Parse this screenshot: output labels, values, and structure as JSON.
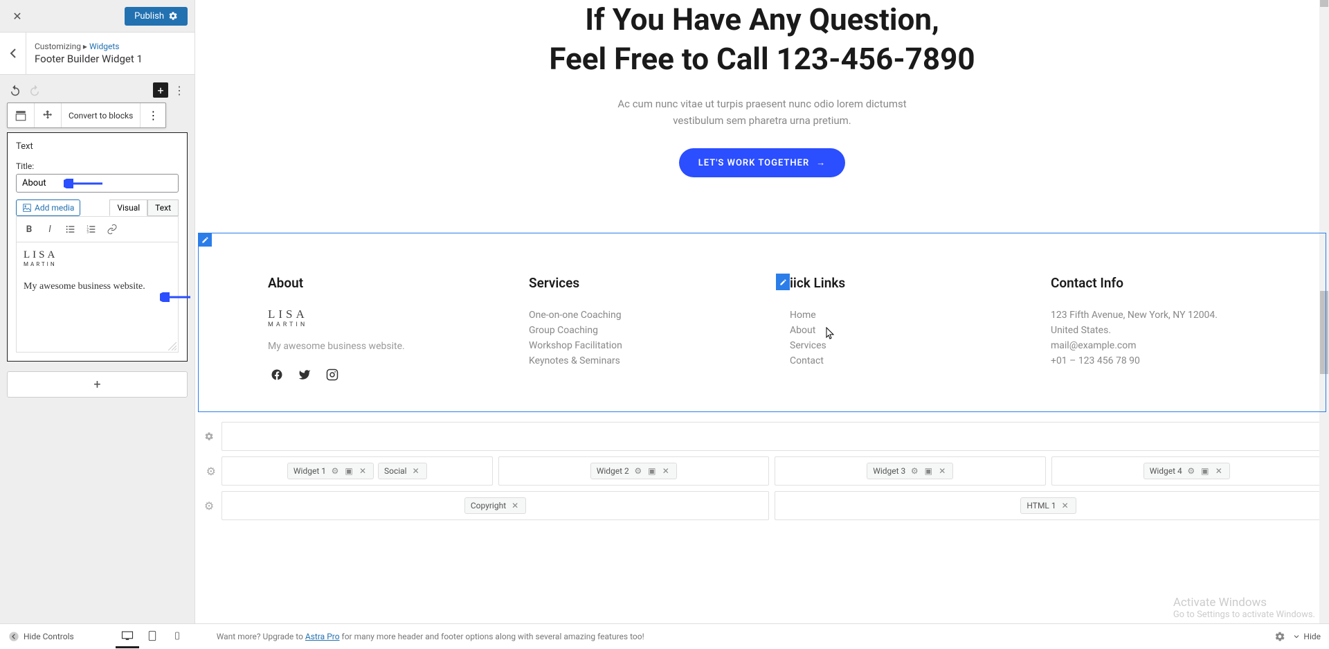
{
  "sidebar": {
    "publish_label": "Publish",
    "breadcrumb_prefix": "Customizing",
    "breadcrumb_link": "Widgets",
    "breadcrumb_title": "Footer Builder Widget 1",
    "convert_label": "Convert to blocks",
    "widget_type": "Text",
    "title_label": "Title:",
    "title_value": "About",
    "add_media_label": "Add media",
    "tab_visual": "Visual",
    "tab_text": "Text",
    "logo_top": "LISA",
    "logo_sub": "MARTIN",
    "body_text": "My awesome business website."
  },
  "hero": {
    "line1": "If You Have Any Question,",
    "line2": "Feel Free to Call 123-456-7890",
    "sub1": "Ac cum nunc vitae ut turpis praesent nunc odio lorem dictumst",
    "sub2": "vestibulum sem pharetra urna pretium.",
    "cta": "LET'S WORK TOGETHER"
  },
  "footer": {
    "about": {
      "title": "About",
      "logo_top": "LISA",
      "logo_sub": "MARTIN",
      "desc": "My awesome business website."
    },
    "services": {
      "title": "Services",
      "items": [
        "One-on-one Coaching",
        "Group Coaching",
        "Workshop Facilitation",
        "Keynotes & Seminars"
      ]
    },
    "quicklinks": {
      "title": "Quick Links",
      "title_partial": "iick Links",
      "items": [
        "Home",
        "About",
        "Services",
        "Contact"
      ]
    },
    "contact": {
      "title": "Contact Info",
      "items": [
        "123 Fifth Avenue, New York, NY 12004.",
        "United States.",
        "mail@example.com",
        "+01 – 123 456 78 90"
      ]
    }
  },
  "builder": {
    "widget1": "Widget 1",
    "social": "Social",
    "widget2": "Widget 2",
    "widget3": "Widget 3",
    "widget4": "Widget 4",
    "copyright": "Copyright",
    "html1": "HTML 1"
  },
  "bottom": {
    "hide_controls": "Hide Controls",
    "upgrade_pre": "Want more? Upgrade to ",
    "upgrade_link": "Astra Pro",
    "upgrade_post": " for many more header and footer options along with several amazing features too!",
    "hide": "Hide"
  },
  "watermark": {
    "title": "Activate Windows",
    "sub": "Go to Settings to activate Windows."
  }
}
